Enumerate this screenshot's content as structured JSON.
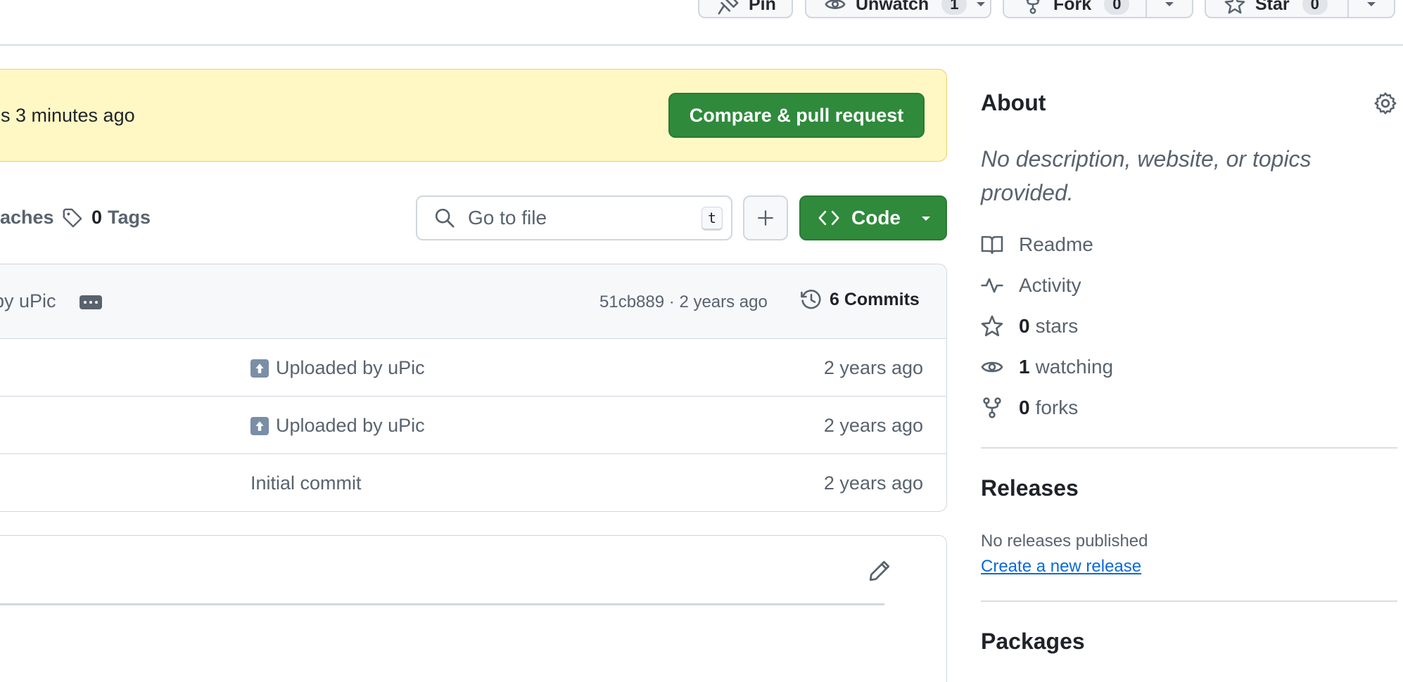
{
  "header": {
    "pin_label": "Pin",
    "unwatch_label": "Unwatch",
    "watch_count": "1",
    "fork_label": "Fork",
    "fork_count": "0",
    "star_label": "Star",
    "star_count": "0"
  },
  "flash": {
    "message": "s 3 minutes ago",
    "compare_label": "Compare & pull request"
  },
  "toolbar": {
    "branches_label": "aches",
    "tags_count": "0",
    "tags_label": "Tags",
    "search_placeholder": "Go to file",
    "search_shortcut": "t",
    "code_label": "Code"
  },
  "latest_commit": {
    "message": "by uPic",
    "hash": "51cb889",
    "separator": "·",
    "age": "2 years ago",
    "commits_label": "6 Commits"
  },
  "files": [
    {
      "message": "Uploaded by uPic",
      "has_upload_icon": true,
      "date": "2 years ago"
    },
    {
      "message": "Uploaded by uPic",
      "has_upload_icon": true,
      "date": "2 years ago"
    },
    {
      "message": "Initial commit",
      "has_upload_icon": false,
      "date": "2 years ago"
    }
  ],
  "sidebar": {
    "about_title": "About",
    "description": "No description, website, or topics provided.",
    "readme_label": "Readme",
    "activity_label": "Activity",
    "stars_count": "0",
    "stars_label": "stars",
    "watching_count": "1",
    "watching_label": "watching",
    "forks_count": "0",
    "forks_label": "forks",
    "releases_title": "Releases",
    "no_releases": "No releases published",
    "create_release": "Create a new release",
    "packages_title": "Packages"
  },
  "colors": {
    "primary_button": "#2f8a3b",
    "flash_background": "#fff8c5",
    "link": "#0969da",
    "muted_text": "#59636e"
  },
  "icons": [
    "pin-icon",
    "eye-icon",
    "fork-icon",
    "star-icon",
    "tag-icon",
    "search-icon",
    "plus-icon",
    "code-icon",
    "history-icon",
    "pencil-icon",
    "gear-icon",
    "book-icon",
    "pulse-icon"
  ]
}
